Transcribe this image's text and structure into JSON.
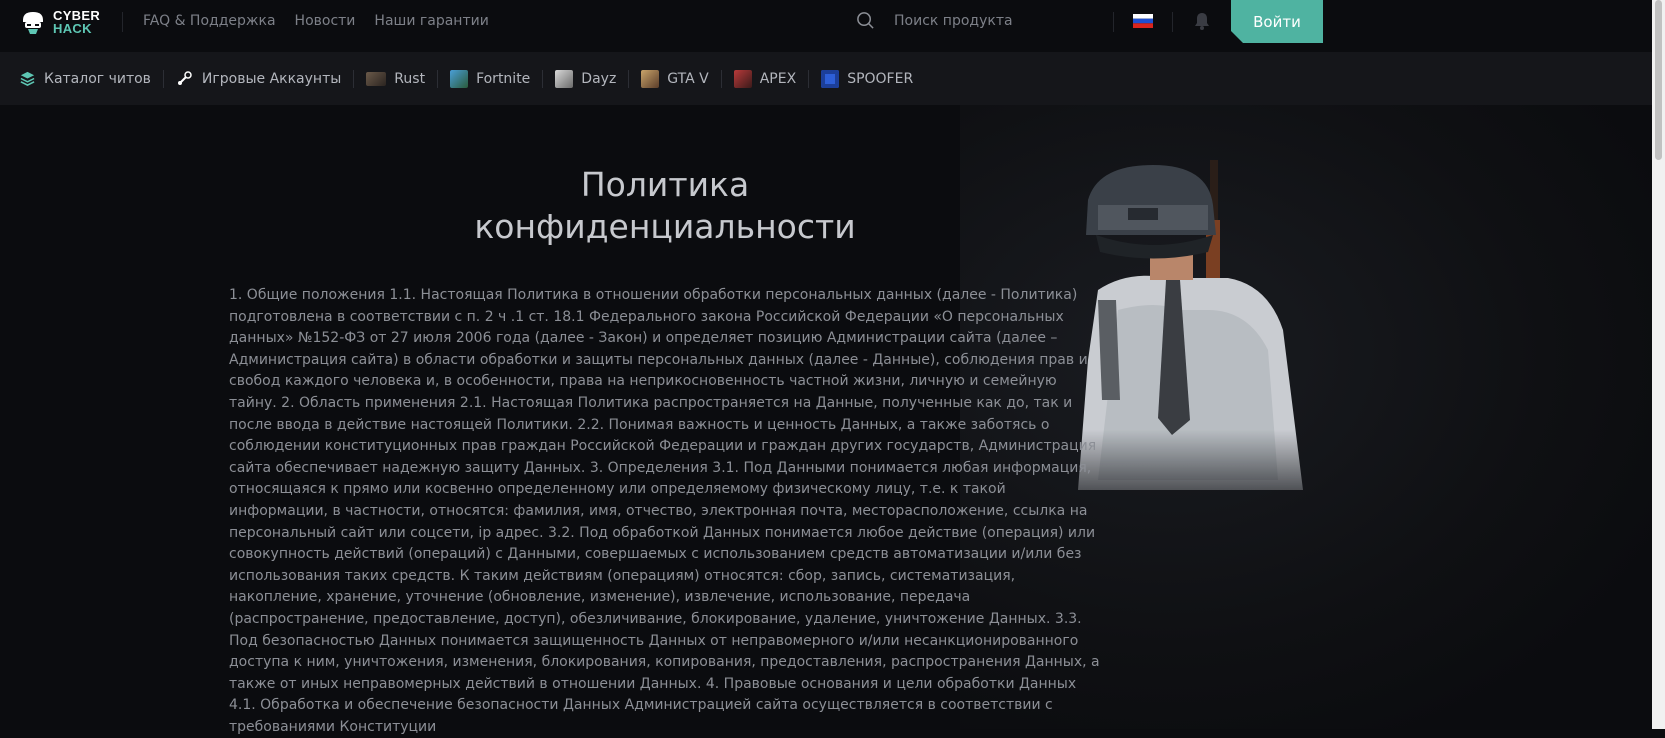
{
  "header": {
    "logo": {
      "line1": "CYBER",
      "line2": "HACK"
    },
    "nav": [
      "FAQ & Поддержка",
      "Новости",
      "Наши гарантии"
    ],
    "search_placeholder": "Поиск продукта",
    "login_label": "Войти",
    "accent_color": "#4fb3a1"
  },
  "categories": [
    {
      "label": "Каталог читов",
      "icon": "layers-icon"
    },
    {
      "label": "Игровые Аккаунты",
      "icon": "steam-icon"
    },
    {
      "label": "Rust",
      "icon": "rust-game-icon"
    },
    {
      "label": "Fortnite",
      "icon": "fortnite-game-icon"
    },
    {
      "label": "Dayz",
      "icon": "dayz-game-icon"
    },
    {
      "label": "GTA V",
      "icon": "gtav-game-icon"
    },
    {
      "label": "APEX",
      "icon": "apex-game-icon"
    },
    {
      "label": "SPOOFER",
      "icon": "spoofer-icon"
    }
  ],
  "page": {
    "title_line1": "Политика",
    "title_line2": "конфиденциальности",
    "body": "1. Общие положения 1.1. Настоящая Политика в отношении обработки персональных данных (далее - Политика) подготовлена в соответствии с п. 2 ч .1 ст. 18.1 Федерального закона Российской Федерации «О персональных данных» №152-ФЗ от 27 июля 2006 года (далее - Закон) и определяет позицию Администрации сайта (далее – Администрация сайта) в области обработки и защиты персональных данных (далее - Данные), соблюдения прав и свобод каждого человека и, в особенности, права на неприкосновенность частной жизни, личную и семейную тайну. 2. Область применения 2.1. Настоящая Политика распространяется на Данные, полученные как до, так и после ввода в действие настоящей Политики. 2.2. Понимая важность и ценность Данных, а также заботясь о соблюдении конституционных прав граждан Российской Федерации и граждан других государств, Администрация сайта обеспечивает надежную защиту Данных. 3. Определения 3.1. Под Данными понимается любая информация, относящаяся к прямо или косвенно определенному или определяемому физическому лицу, т.е. к такой информации, в частности, относятся: фамилия, имя, отчество, электронная почта, месторасположение, ссылка на персональный сайт или соцсети, ip адрес. 3.2. Под обработкой Данных понимается любое действие (операция) или совокупность действий (операций) с Данными, совершаемых с использованием средств автоматизации и/или без использования таких средств. К таким действиям (операциям) относятся: сбор, запись, систематизация, накопление, хранение, уточнение (обновление, изменение), извлечение, использование, передача (распространение, предоставление, доступ), обезличивание, блокирование, удаление, уничтожение Данных. 3.3. Под безопасностью Данных понимается защищенность Данных от неправомерного и/или несанкционированного доступа к ним, уничтожения, изменения, блокирования, копирования, предоставления, распространения Данных, а также от иных неправомерных действий в отношении Данных. 4. Правовые основания и цели обработки Данных 4.1. Обработка и обеспечение безопасности Данных Администрацией сайта осуществляется в соответствии с требованиями Конституции"
  }
}
